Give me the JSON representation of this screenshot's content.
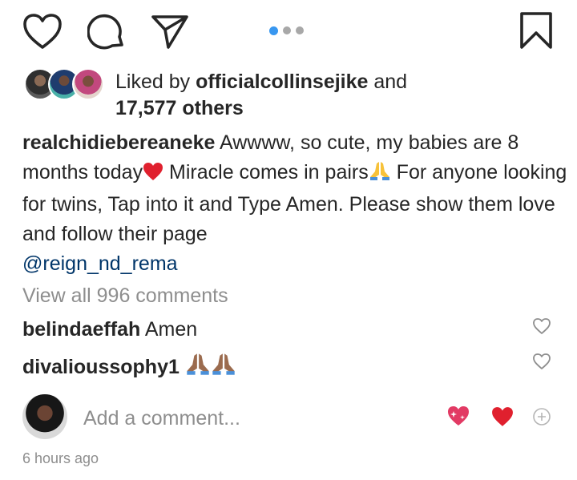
{
  "action_bar": {
    "like_icon": "heart-outline-icon",
    "comment_icon": "comment-bubble-icon",
    "share_icon": "send-paper-plane-icon",
    "save_icon": "bookmark-icon",
    "carousel_dots": 3,
    "active_dot": 1,
    "accent_color": "#3897f0"
  },
  "likes": {
    "prefix": "Liked by ",
    "user": "officialcollinsejike",
    "and": " and",
    "others": "17,577 others"
  },
  "caption": {
    "username": "realchidiebereaneke",
    "text1": " Awwww, so cute, my babies are 8 months today",
    "text2": " Miracle comes in pairs",
    "text3": " For anyone looking for twins, Tap into it and Type Amen. Please show them love and follow their page",
    "mention": "@reign_nd_rema"
  },
  "view_all_comments": "View all 996 comments",
  "comments": [
    {
      "username": "belindaeffah",
      "text": " Amen"
    },
    {
      "username": "divalioussophy1",
      "text": " "
    }
  ],
  "add_comment": {
    "placeholder": "Add a comment...",
    "quick_reactions": [
      "sparkling-heart-icon",
      "red-heart-icon",
      "add-circle-icon"
    ]
  },
  "timestamp": "6 hours ago"
}
